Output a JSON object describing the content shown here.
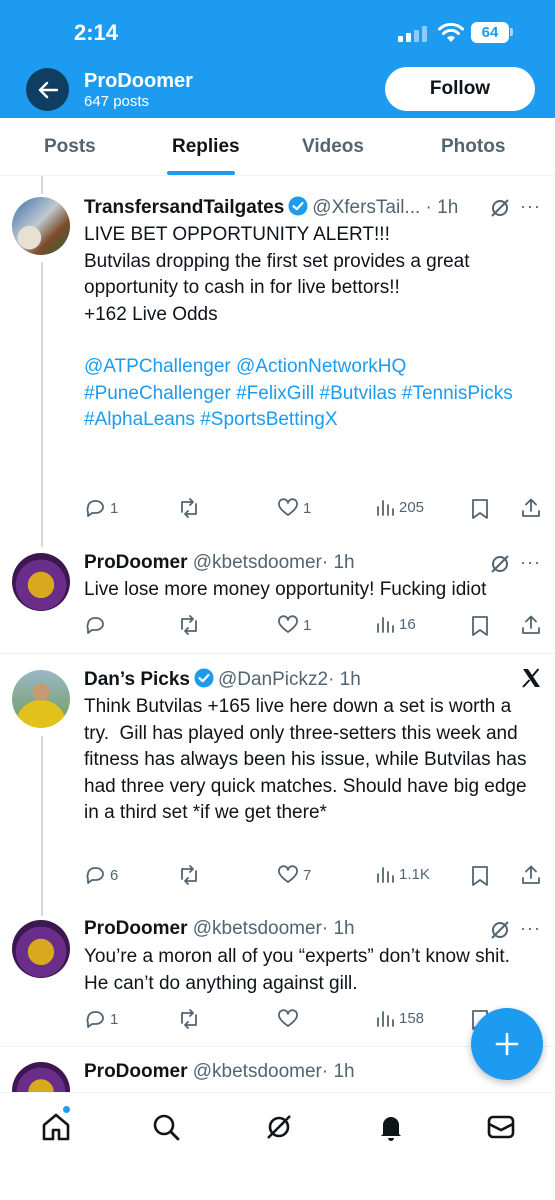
{
  "status_bar": {
    "time": "2:14",
    "battery": "64"
  },
  "header": {
    "profile_name": "ProDoomer",
    "post_count": "647 posts",
    "follow_label": "Follow"
  },
  "tabs": [
    {
      "label": "Posts",
      "active": false
    },
    {
      "label": "Replies",
      "active": true
    },
    {
      "label": "Videos",
      "active": false
    },
    {
      "label": "Photos",
      "active": false
    }
  ],
  "posts": [
    {
      "name": "TransfersandTailgates",
      "verified": true,
      "handle": "@XfersTail...",
      "time": "· 1h",
      "text_lines": [
        "LIVE BET OPPORTUNITY ALERT!!!",
        "",
        "Butvilas dropping the first set provides a great opportunity to cash in for live bettors!!",
        "",
        "+162 Live Odds"
      ],
      "links": [
        "@ATPChallenger @ActionNetworkHQ #PuneChallenger #FelixGill #Butvilas #TennisPicks #AlphaLeans #SportsBettingX"
      ],
      "replies": "1",
      "reposts": "",
      "likes": "1",
      "views": "205"
    },
    {
      "name": "ProDoomer",
      "verified": false,
      "handle": "@kbetsdoomer",
      "time": "· 1h",
      "text_lines": [
        "Live lose more money opportunity! Fucking idiot"
      ],
      "replies": "",
      "reposts": "",
      "likes": "1",
      "views": "16"
    },
    {
      "name": "Dan’s Picks",
      "verified": true,
      "handle": "@DanPickz2",
      "time": "· 1h",
      "text_lines": [
        "Think Butvilas +165 live here down a set is worth a try.  Gill has played only three-setters this week and fitness has always been his issue, while Butvilas has had three very quick matches. Should have big edge in a third set *if we get there*"
      ],
      "replies": "6",
      "reposts": "",
      "likes": "7",
      "views": "1.1K"
    },
    {
      "name": "ProDoomer",
      "verified": false,
      "handle": "@kbetsdoomer",
      "time": "· 1h",
      "text_lines": [
        "You’re a moron all of you “experts” don’t know shit. He can’t do anything against gill."
      ],
      "replies": "1",
      "reposts": "",
      "likes": "",
      "views": "158"
    },
    {
      "name": "ProDoomer",
      "verified": false,
      "handle": "@kbetsdoomer",
      "time": "· 1h"
    }
  ],
  "icons": {
    "back": "arrow-left-icon",
    "grok": "slashed-circle-icon",
    "more": "more-dots-icon",
    "x_logo": "x-logo-icon",
    "fab": "plus-icon",
    "nav": [
      "home-icon",
      "search-icon",
      "grok-icon",
      "bell-icon",
      "mail-icon"
    ]
  },
  "colors": {
    "brand": "#1d9bf0",
    "text": "#0f1419",
    "muted": "#536471"
  }
}
